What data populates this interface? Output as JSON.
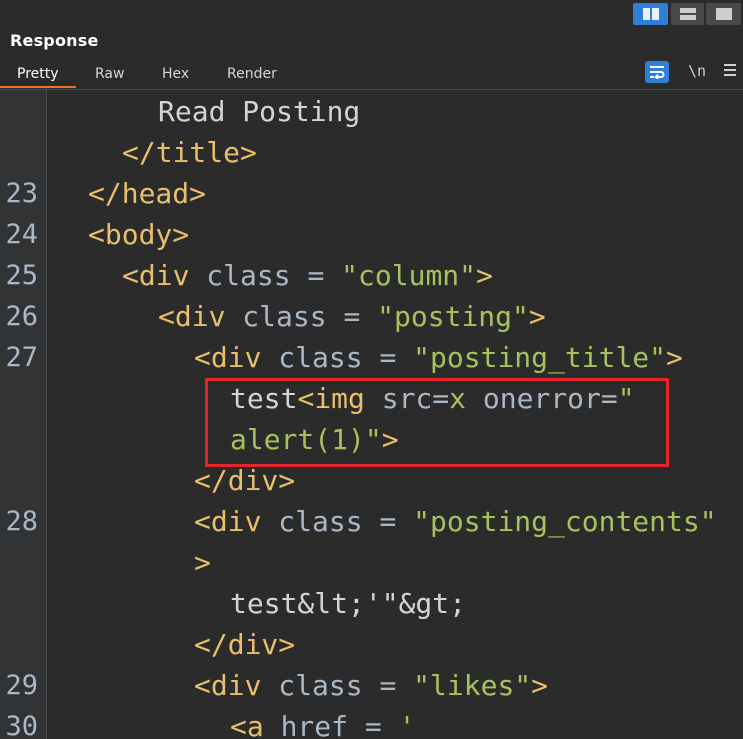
{
  "panel": {
    "title": "Response",
    "view_toggles": [
      "split-columns-icon",
      "split-rows-icon",
      "single-pane-icon"
    ],
    "tabs": [
      {
        "label": "Pretty",
        "active": true
      },
      {
        "label": "Raw",
        "active": false
      },
      {
        "label": "Hex",
        "active": false
      },
      {
        "label": "Render",
        "active": false
      }
    ],
    "tools": {
      "wrap_icon": "word-wrap-icon",
      "newline_label": "\\n",
      "menu_icon": "hamburger-menu-icon"
    },
    "accent_color": "#e8722c",
    "selected_color": "#2f7fd6"
  },
  "code_lines": [
    {
      "num": "",
      "tokens": [
        {
          "t": "Read Posting",
          "c": "plain"
        }
      ]
    },
    {
      "num": "",
      "tokens": [
        {
          "t": "</title>",
          "c": "tag"
        }
      ]
    },
    {
      "num": "23",
      "tokens": [
        {
          "t": "</head>",
          "c": "tag"
        }
      ]
    },
    {
      "num": "24",
      "tokens": [
        {
          "t": "<body>",
          "c": "tag"
        }
      ]
    },
    {
      "num": "25",
      "tokens": [
        {
          "t": "<div ",
          "c": "tag"
        },
        {
          "t": "class = ",
          "c": "attr"
        },
        {
          "t": "\"column\"",
          "c": "str"
        },
        {
          "t": ">",
          "c": "tag"
        }
      ]
    },
    {
      "num": "26",
      "tokens": [
        {
          "t": "<div ",
          "c": "tag"
        },
        {
          "t": "class = ",
          "c": "attr"
        },
        {
          "t": "\"posting\"",
          "c": "str"
        },
        {
          "t": ">",
          "c": "tag"
        }
      ]
    },
    {
      "num": "27",
      "tokens": [
        {
          "t": "<div ",
          "c": "tag"
        },
        {
          "t": "class = ",
          "c": "attr"
        },
        {
          "t": "\"posting_title\"",
          "c": "str"
        },
        {
          "t": ">",
          "c": "tag"
        }
      ]
    },
    {
      "num": "",
      "tokens": [
        {
          "t": "test",
          "c": "plain"
        },
        {
          "t": "<img ",
          "c": "tag"
        },
        {
          "t": "src=",
          "c": "attr"
        },
        {
          "t": "x ",
          "c": "str"
        },
        {
          "t": "onerror=",
          "c": "attr"
        },
        {
          "t": "\"",
          "c": "str"
        }
      ]
    },
    {
      "num": "",
      "tokens": [
        {
          "t": "alert(1)\"",
          "c": "str"
        },
        {
          "t": ">",
          "c": "tag"
        }
      ]
    },
    {
      "num": "",
      "tokens": [
        {
          "t": "</div>",
          "c": "tag"
        }
      ]
    },
    {
      "num": "28",
      "tokens": [
        {
          "t": "<div ",
          "c": "tag"
        },
        {
          "t": "class = ",
          "c": "attr"
        },
        {
          "t": "\"posting_contents\"",
          "c": "str"
        }
      ]
    },
    {
      "num": "",
      "tokens": [
        {
          "t": ">",
          "c": "tag"
        }
      ]
    },
    {
      "num": "",
      "tokens": [
        {
          "t": "test&lt;'\"&gt;",
          "c": "plain"
        }
      ]
    },
    {
      "num": "",
      "tokens": [
        {
          "t": "</div>",
          "c": "tag"
        }
      ]
    },
    {
      "num": "29",
      "tokens": [
        {
          "t": "<div ",
          "c": "tag"
        },
        {
          "t": "class = ",
          "c": "attr"
        },
        {
          "t": "\"likes\"",
          "c": "str"
        },
        {
          "t": ">",
          "c": "tag"
        }
      ]
    },
    {
      "num": "30",
      "tokens": [
        {
          "t": "<a ",
          "c": "tag"
        },
        {
          "t": "href = ",
          "c": "attr"
        },
        {
          "t": "'",
          "c": "str"
        }
      ]
    }
  ]
}
